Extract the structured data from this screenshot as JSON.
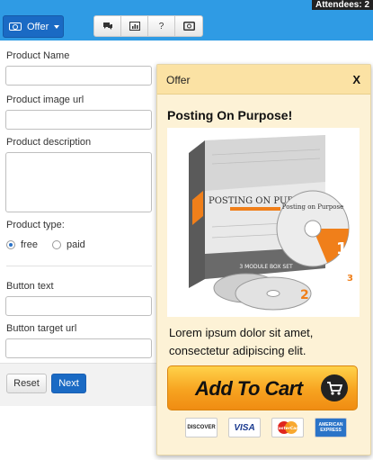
{
  "topbar": {
    "attendees": "Attendees: 2",
    "offer_button_label": "Offer",
    "tools": [
      {
        "icon": "chat-icon",
        "glyph": "💬"
      },
      {
        "icon": "poll-icon",
        "glyph": "▥"
      },
      {
        "icon": "question-icon",
        "glyph": "?"
      },
      {
        "icon": "offer-ticket-icon",
        "glyph": "▣"
      }
    ]
  },
  "form": {
    "product_name_label": "Product Name",
    "product_name_value": "",
    "product_image_label": "Product image url",
    "product_image_value": "",
    "product_description_label": "Product description",
    "product_description_value": "",
    "product_type_label": "Product type:",
    "type_free_label": "free",
    "type_paid_label": "paid",
    "button_text_label": "Button text",
    "button_text_value": "",
    "button_target_label": "Button target url",
    "button_target_value": "",
    "reset_label": "Reset",
    "next_label": "Next"
  },
  "panel": {
    "title": "Offer",
    "close": "X",
    "offer_title": "Posting On Purpose!",
    "product_box_title_line1": "POSTING ON PURPOSE",
    "product_box_subtitle": "3 MODULE BOX SET",
    "disc_label": "Posting on Purpose",
    "disc_numbers": [
      "1",
      "2",
      "3"
    ],
    "description": "Lorem ipsum dolor sit amet, consectetur adipiscing elit.",
    "cart_label": "Add To Cart",
    "cards": [
      "DISCOVER",
      "VISA",
      "MasterCard",
      "AMERICAN EXPRESS"
    ]
  },
  "colors": {
    "topbar": "#2f9be4",
    "offer_button": "#1a6ac4",
    "panel_bg": "#fdf2d6",
    "panel_header": "#fbe2a4",
    "cart_orange": "#f7a320",
    "accent_orange": "#f07f1a"
  }
}
